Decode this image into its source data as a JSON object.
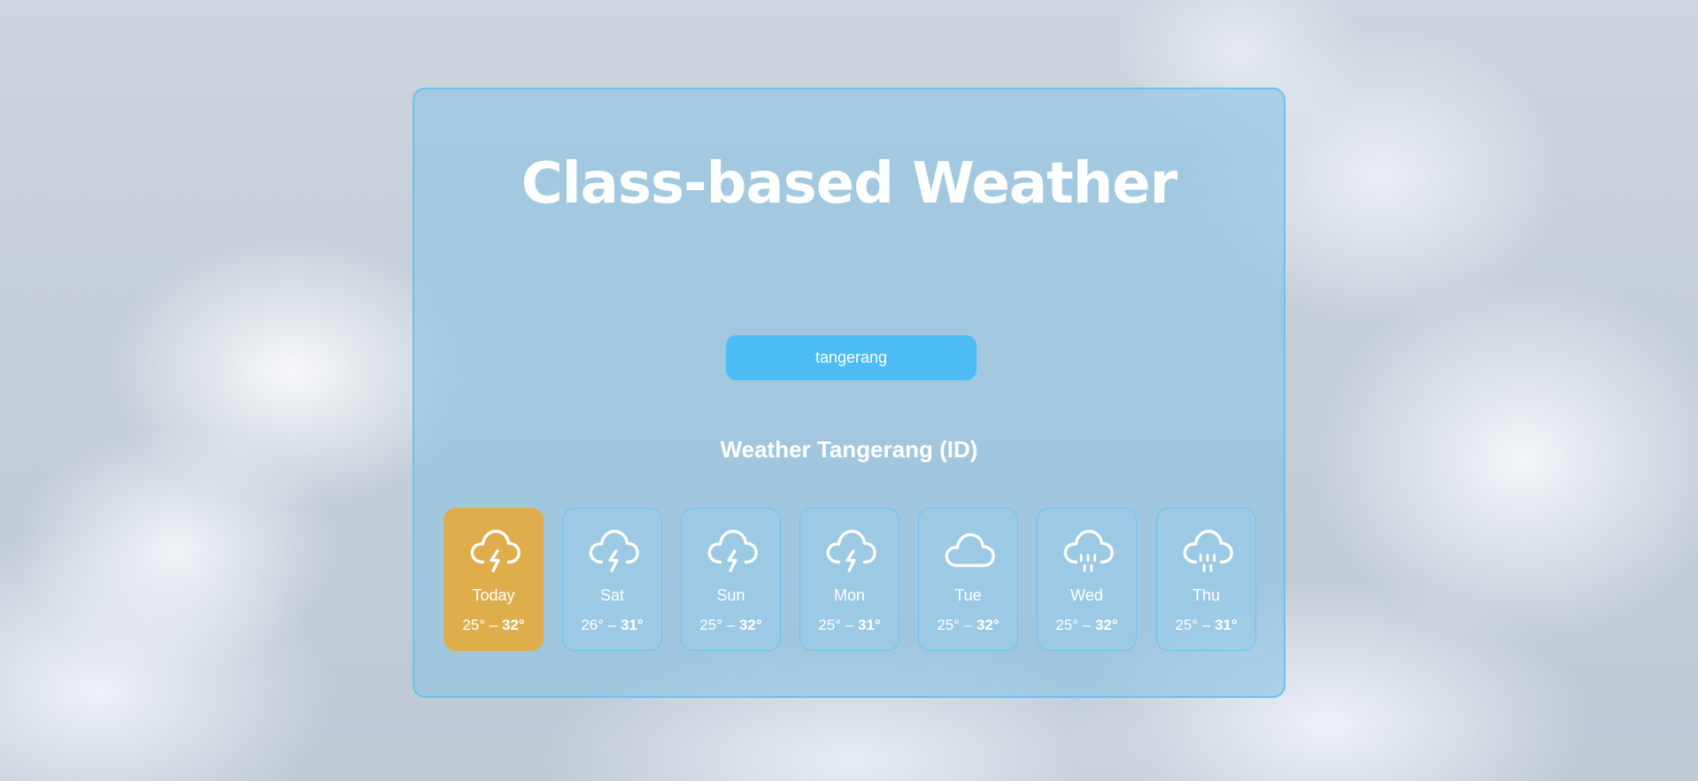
{
  "app": {
    "title": "Class-based Weather",
    "search_value": "tangerang",
    "location_heading": "Weather Tangerang (ID)"
  },
  "forecast": [
    {
      "day": "Today",
      "low": "25°",
      "sep": " – ",
      "high": "32°",
      "icon": "thunderstorm-icon",
      "active": true
    },
    {
      "day": "Sat",
      "low": "26°",
      "sep": " – ",
      "high": "31°",
      "icon": "thunderstorm-icon",
      "active": false
    },
    {
      "day": "Sun",
      "low": "25°",
      "sep": " – ",
      "high": "32°",
      "icon": "thunderstorm-icon",
      "active": false
    },
    {
      "day": "Mon",
      "low": "25°",
      "sep": " – ",
      "high": "31°",
      "icon": "thunderstorm-icon",
      "active": false
    },
    {
      "day": "Tue",
      "low": "25°",
      "sep": " – ",
      "high": "32°",
      "icon": "cloud-icon",
      "active": false
    },
    {
      "day": "Wed",
      "low": "25°",
      "sep": " – ",
      "high": "32°",
      "icon": "rain-cloud-icon",
      "active": false
    },
    {
      "day": "Thu",
      "low": "25°",
      "sep": " – ",
      "high": "31°",
      "icon": "rain-cloud-icon",
      "active": false
    }
  ],
  "colors": {
    "card_border": "#6cc2ee",
    "search_bg": "#4dbcf5",
    "active_day_bg": "#deae4c",
    "text": "#ffffff"
  }
}
